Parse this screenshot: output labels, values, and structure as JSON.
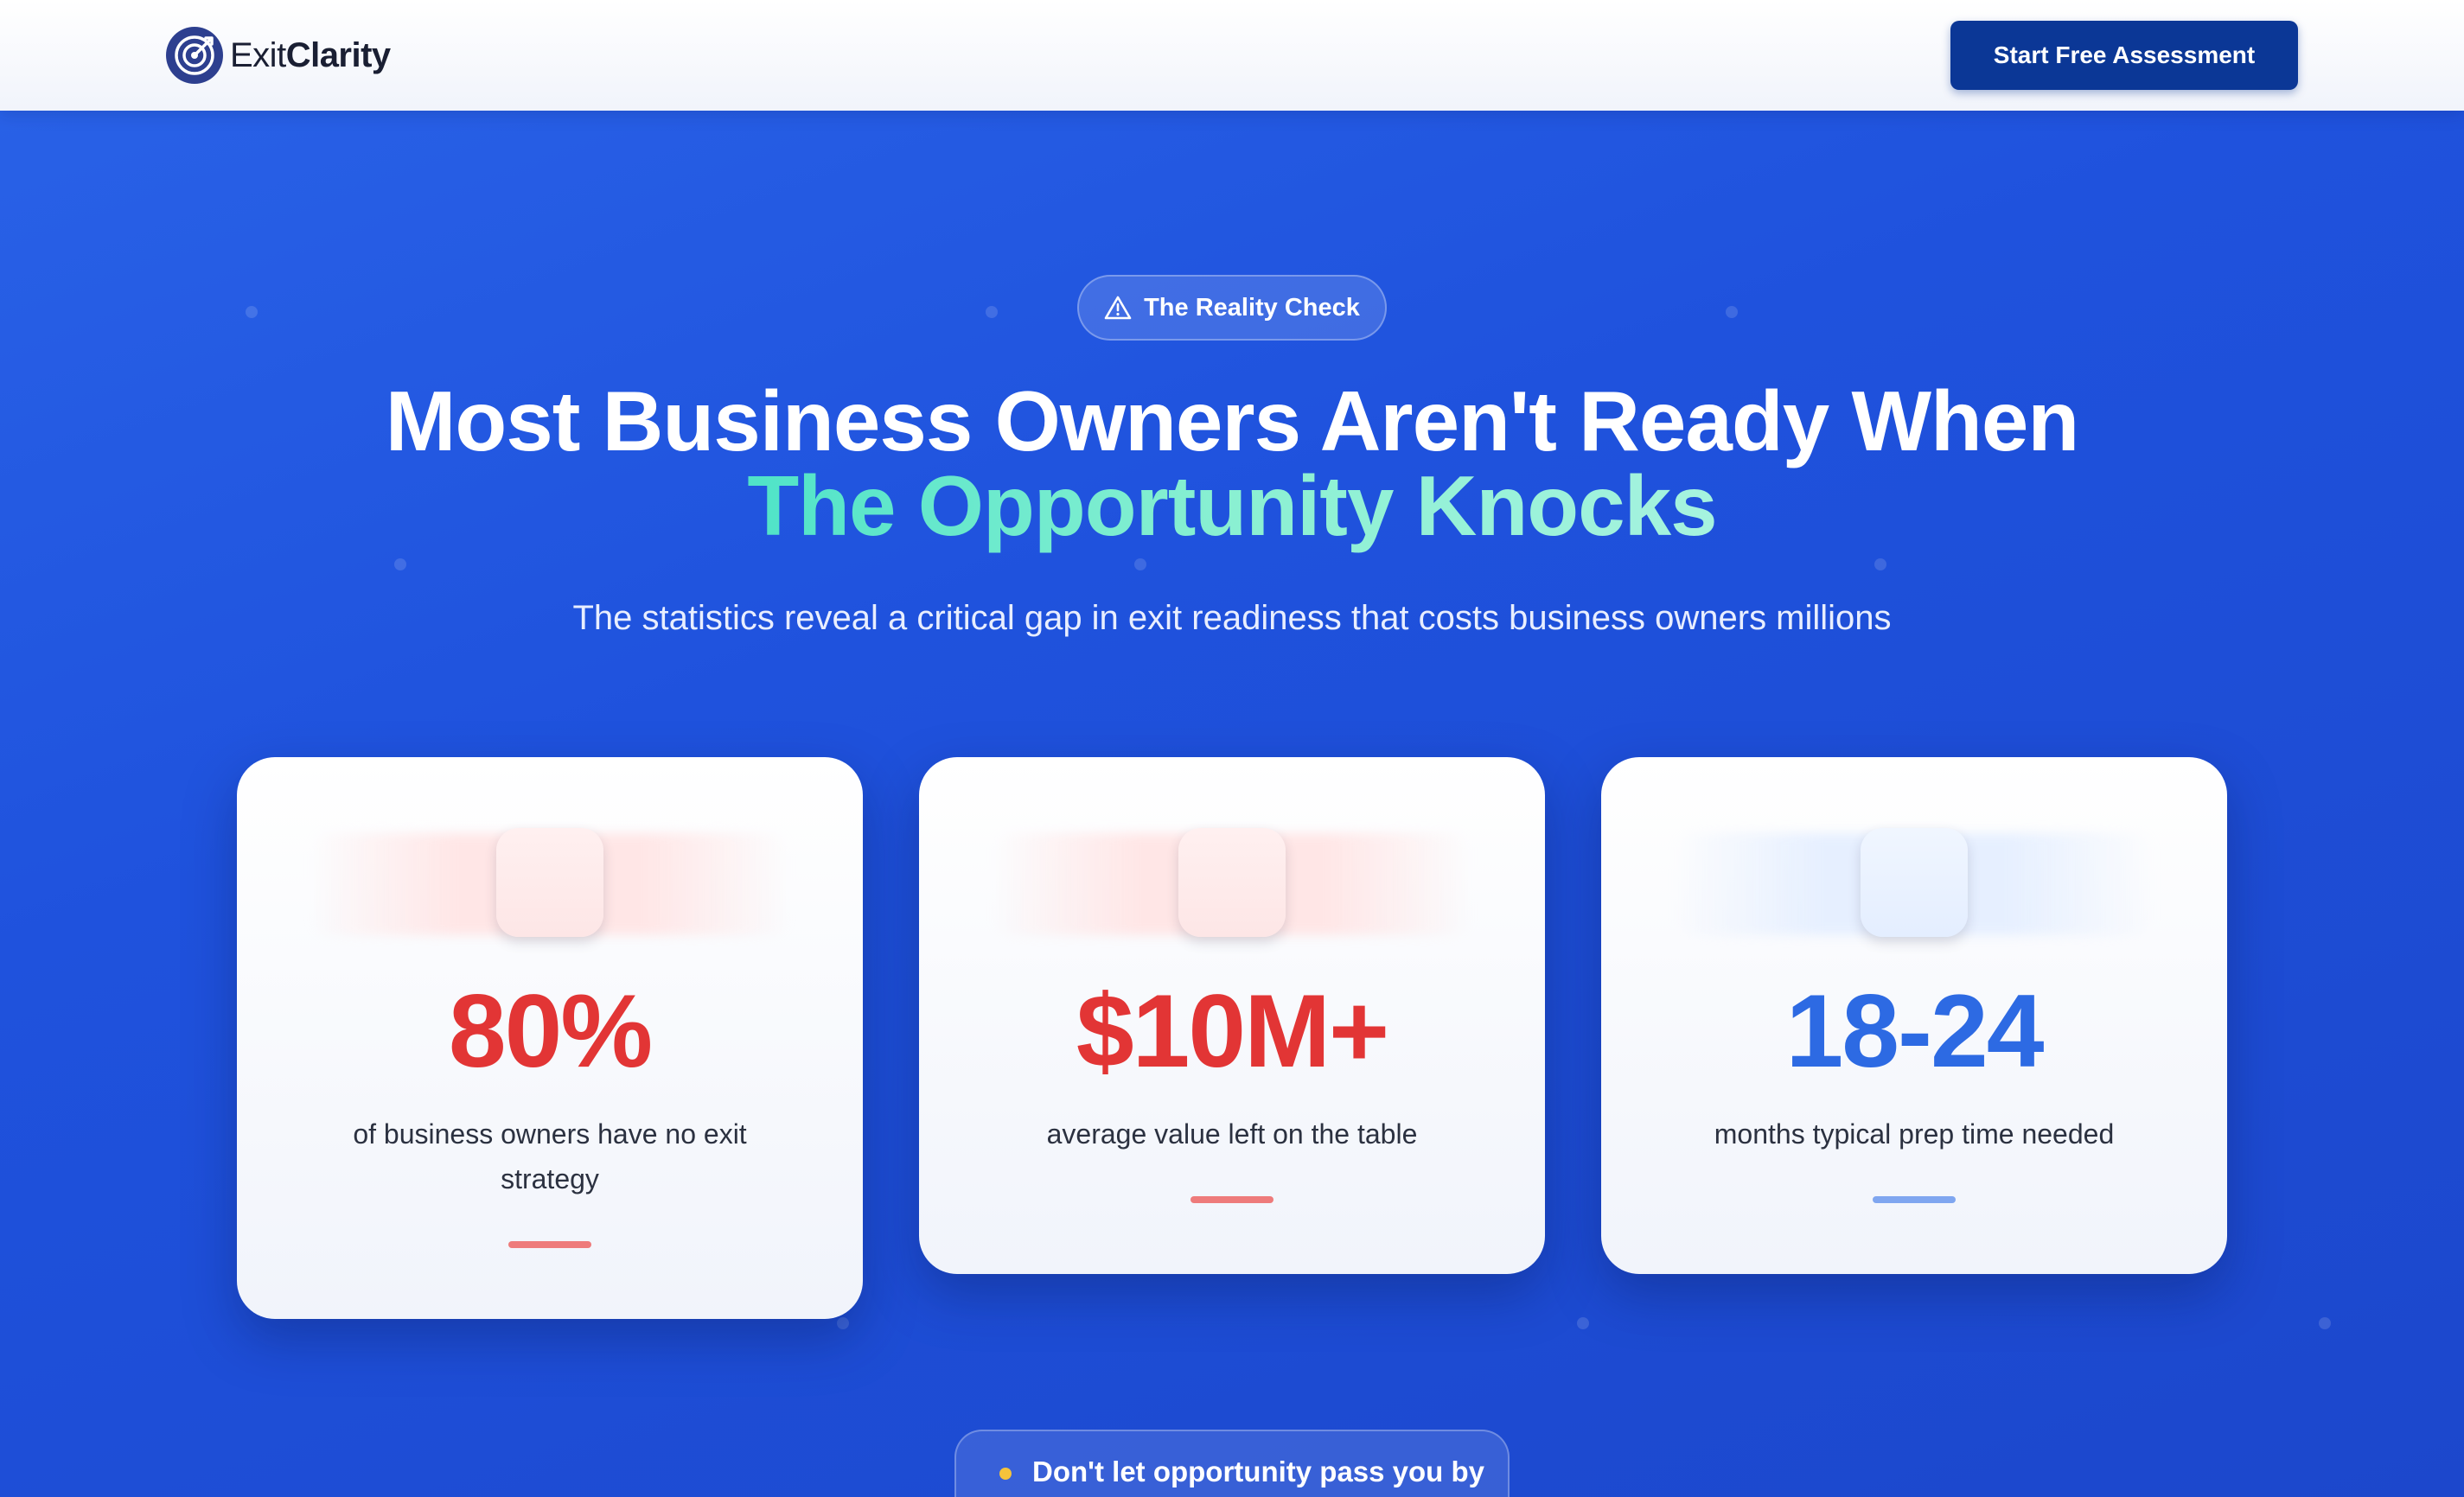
{
  "header": {
    "brand_regular": "Exit",
    "brand_bold": "Clarity",
    "logo_icon": "target-icon",
    "cta_label": "Start Free Assessment"
  },
  "hero": {
    "badge_icon": "warning-triangle-icon",
    "badge_label": "The Reality Check",
    "headline_line1": "Most Business Owners Aren't Ready When",
    "headline_line2": "The Opportunity Knocks",
    "subheadline": "The statistics reveal a critical gap in exit readiness that costs business owners millions"
  },
  "stats": [
    {
      "value": "80%",
      "description": "of business owners have no exit strategy",
      "accent": "#e23535"
    },
    {
      "value": "$10M+",
      "description": "average value left on the table",
      "accent": "#e23535"
    },
    {
      "value": "18-24",
      "description": "months typical prep time needed",
      "accent": "#2d6ae3"
    }
  ],
  "footer_pill": {
    "label": "Don't let opportunity pass you by",
    "dot_color": "#f5c33b"
  },
  "colors": {
    "background": "#1f52dd",
    "cta": "#0b3796",
    "accent_teal": "#4fe3c8"
  }
}
